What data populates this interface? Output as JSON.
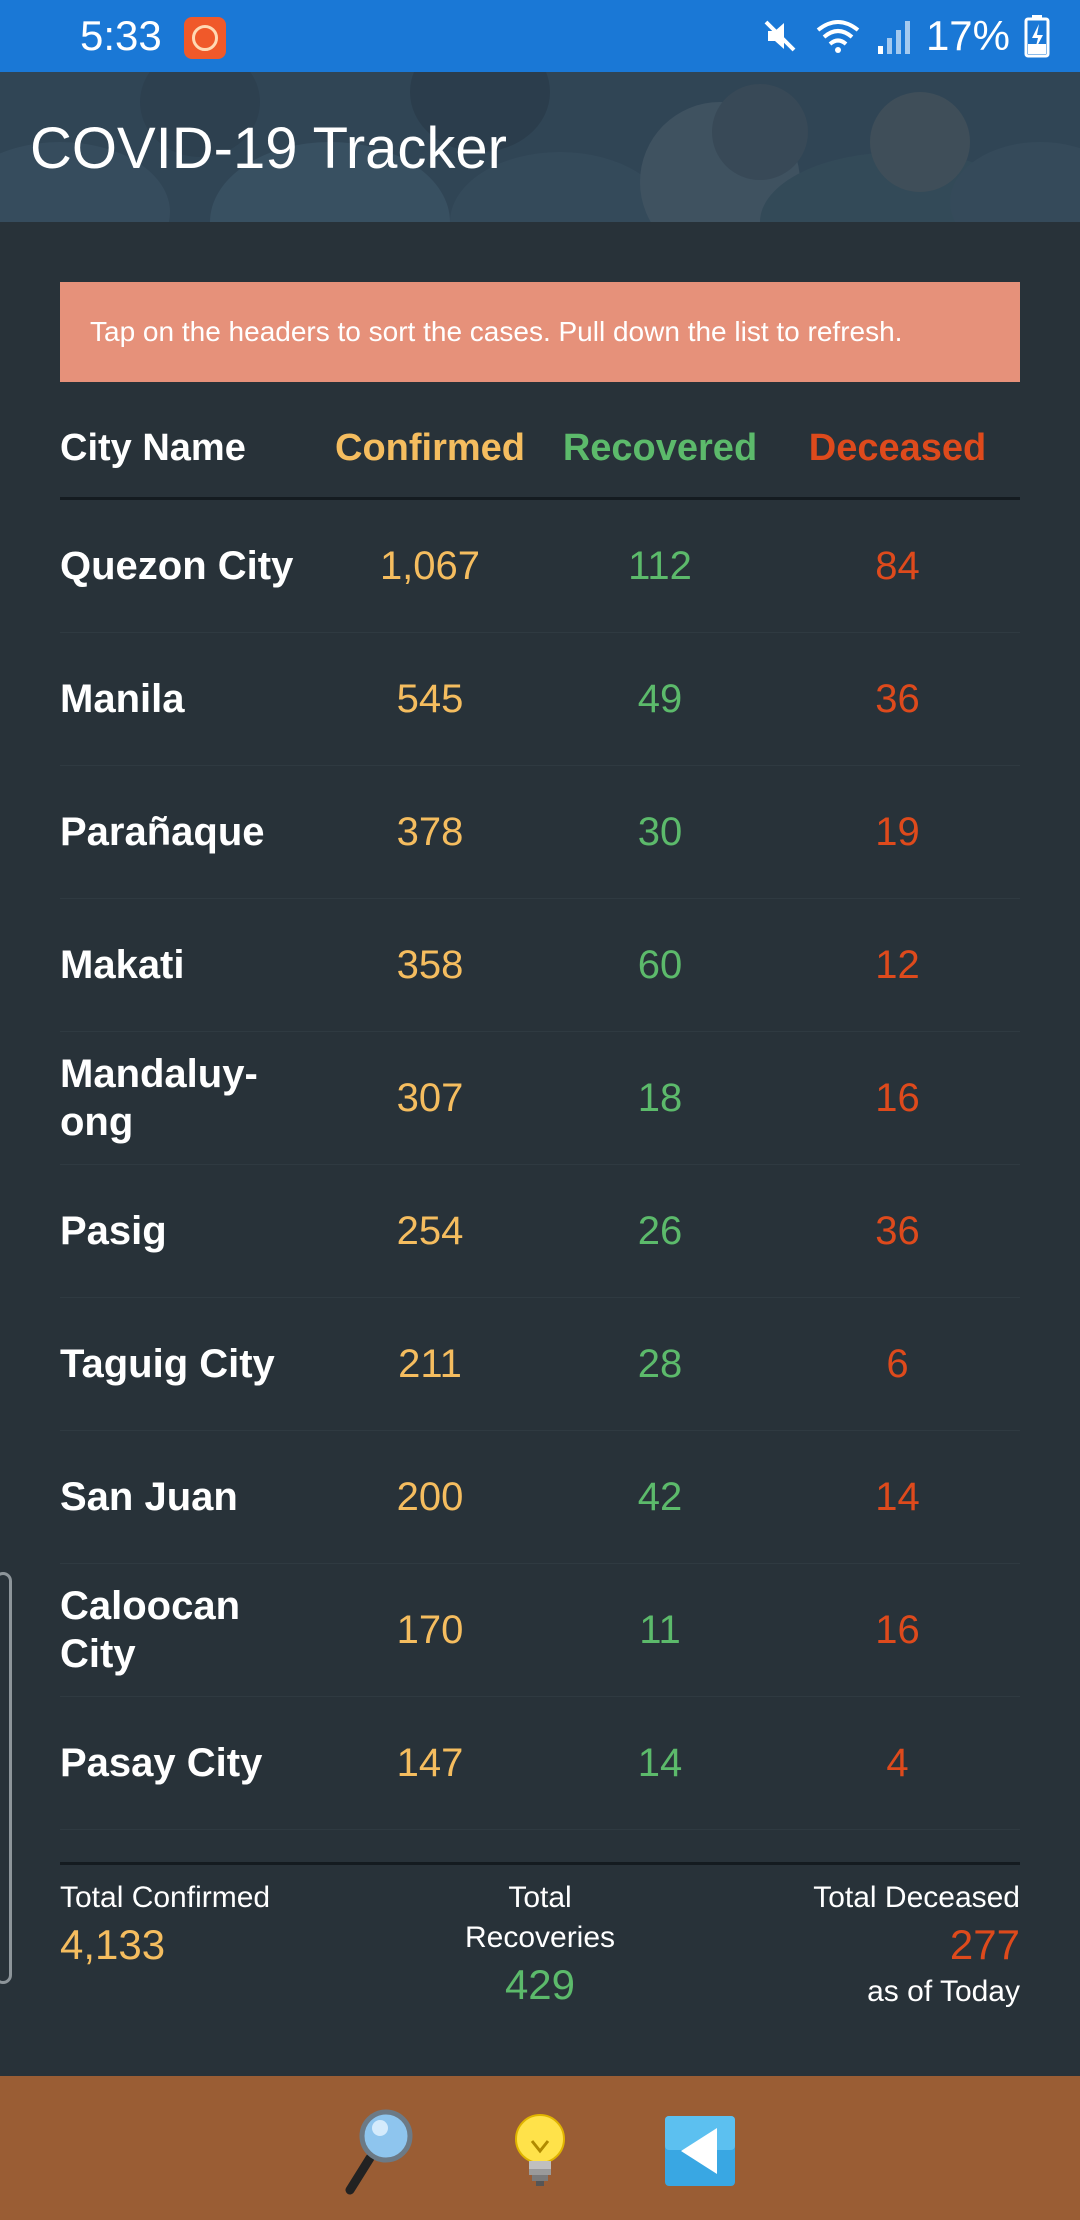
{
  "status_bar": {
    "time": "5:33",
    "battery_percent": "17%",
    "icons": [
      "notification-app-icon",
      "mute-icon",
      "wifi-icon",
      "signal-icon",
      "battery-charging-icon"
    ]
  },
  "header": {
    "title": "COVID-19 Tracker"
  },
  "banner": {
    "text": "Tap on the headers to sort the cases. Pull down the list to refresh."
  },
  "table": {
    "headers": {
      "city": "City Name",
      "confirmed": "Confirmed",
      "recovered": "Recovered",
      "deceased": "Deceased"
    },
    "rows": [
      {
        "city": "Quezon City",
        "confirmed": "1,067",
        "recovered": "112",
        "deceased": "84"
      },
      {
        "city": "Manila",
        "confirmed": "545",
        "recovered": "49",
        "deceased": "36"
      },
      {
        "city": "Parañaque",
        "confirmed": "378",
        "recovered": "30",
        "deceased": "19"
      },
      {
        "city": "Makati",
        "confirmed": "358",
        "recovered": "60",
        "deceased": "12"
      },
      {
        "city": "Mandaluy-\nong",
        "confirmed": "307",
        "recovered": "18",
        "deceased": "16"
      },
      {
        "city": "Pasig",
        "confirmed": "254",
        "recovered": "26",
        "deceased": "36"
      },
      {
        "city": "Taguig City",
        "confirmed": "211",
        "recovered": "28",
        "deceased": "6"
      },
      {
        "city": "San Juan",
        "confirmed": "200",
        "recovered": "42",
        "deceased": "14"
      },
      {
        "city": "Caloocan City",
        "confirmed": "170",
        "recovered": "11",
        "deceased": "16"
      },
      {
        "city": "Pasay City",
        "confirmed": "147",
        "recovered": "14",
        "deceased": "4"
      }
    ]
  },
  "totals": {
    "confirmed_label": "Total Confirmed",
    "confirmed_value": "4,133",
    "recoveries_label": "Total Recoveries",
    "recoveries_value": "429",
    "deceased_label": "Total Deceased",
    "deceased_value": "277",
    "as_of": "as of Today"
  },
  "bottom_nav": {
    "buttons": [
      "search-icon",
      "lightbulb-icon",
      "back-icon"
    ]
  },
  "colors": {
    "status_bar": "#1a78d6",
    "background": "#283239",
    "banner": "#e6917a",
    "confirmed": "#f5bd5f",
    "recovered": "#5cba6b",
    "deceased": "#de4a1c",
    "bottom_nav": "#9a5d34"
  }
}
